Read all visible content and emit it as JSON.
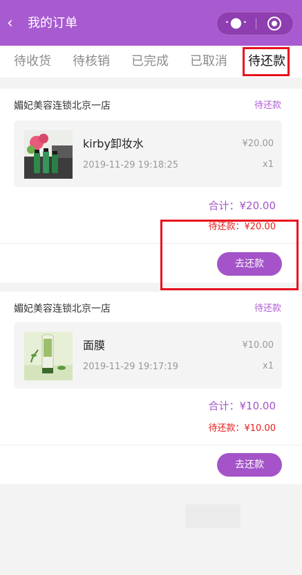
{
  "header": {
    "title": "我的订单",
    "back_icon": "chevron-left-icon",
    "more_icon": "more-dots-icon",
    "close_icon": "record-circle-icon",
    "background": "#a85ad0"
  },
  "tabs": [
    {
      "label": "待收货"
    },
    {
      "label": "待核销"
    },
    {
      "label": "已完成"
    },
    {
      "label": "已取消"
    },
    {
      "label": "待还款",
      "active": true
    }
  ],
  "orders": [
    {
      "store": "媚妃美容连锁北京一店",
      "status": "待还款",
      "product": {
        "name": "kirby卸妆水",
        "date": "2019-11-29 19:18:25",
        "price": "¥20.00",
        "qty": "x1",
        "image": "toner-bottles-with-flowers"
      },
      "total": "合计：¥20.00",
      "due": "待还款：¥20.00",
      "button": "去还款"
    },
    {
      "store": "媚妃美容连锁北京一店",
      "status": "待还款",
      "product": {
        "name": "面膜",
        "date": "2019-11-29 19:17:19",
        "price": "¥10.00",
        "qty": "x1",
        "image": "facial-mask-tube"
      },
      "total": "合计：¥10.00",
      "due": "待还款：¥10.00",
      "button": "去还款"
    }
  ],
  "colors": {
    "accent": "#a454c8",
    "due": "#e61a1a",
    "annotation": "#e8101c"
  }
}
